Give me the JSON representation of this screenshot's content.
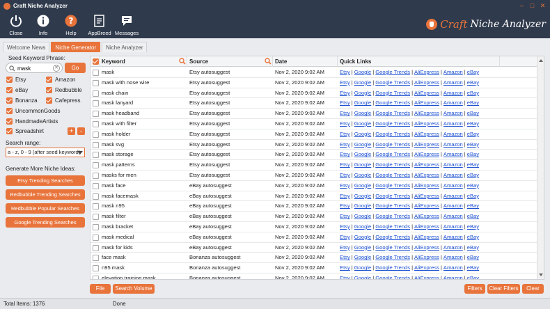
{
  "window": {
    "title": "Craft Niche Analyzer"
  },
  "toolbar": {
    "buttons": [
      {
        "label": "Close"
      },
      {
        "label": "Info"
      },
      {
        "label": "Help"
      },
      {
        "label": "AppBreed"
      },
      {
        "label": "Messages"
      }
    ],
    "brand_word1": "Craft",
    "brand_word2": "Niche Analyzer"
  },
  "tabs": [
    {
      "label": "Welcome News",
      "active": false
    },
    {
      "label": "Niche Generator",
      "active": true
    },
    {
      "label": "Niche Analyzer",
      "active": false
    }
  ],
  "left": {
    "seed_label": "Seed Keyword Phrase:",
    "seed_value": "mask",
    "go_label": "Go",
    "sources": [
      {
        "label": "Etsy",
        "checked": true
      },
      {
        "label": "Amazon",
        "checked": true
      },
      {
        "label": "eBay",
        "checked": true
      },
      {
        "label": "Redbubble",
        "checked": true
      },
      {
        "label": "Bonanza",
        "checked": true
      },
      {
        "label": "Cafepress",
        "checked": true
      },
      {
        "label": "UncommonGoods",
        "checked": true
      },
      {
        "label": "HandmadeArtists",
        "checked": true
      },
      {
        "label": "Spreadshirt",
        "checked": true
      }
    ],
    "plus_label": "+",
    "minus_label": "-",
    "range_label": "Search range:",
    "range_value": "a - z, 0 - 9 (after seed keyword)",
    "more_label": "Generate More Niche Ideas:",
    "gen_buttons": [
      "Etsy Trending Searches",
      "Redbubble Trending Searches",
      "Redbubble Popular Searches",
      "Google Trending Searches"
    ]
  },
  "grid": {
    "columns": [
      "Keyword",
      "Source",
      "Date",
      "Quick Links"
    ],
    "links": [
      "Etsy",
      "Google",
      "Google Trends",
      "AliExpress",
      "Amazon",
      "eBay"
    ],
    "rows": [
      {
        "keyword": "mask",
        "source": "Etsy autosuggest",
        "date": "Nov 2, 2020 9:02 AM"
      },
      {
        "keyword": "mask with nose wire",
        "source": "Etsy autosuggest",
        "date": "Nov 2, 2020 9:02 AM"
      },
      {
        "keyword": "mask chain",
        "source": "Etsy autosuggest",
        "date": "Nov 2, 2020 9:02 AM"
      },
      {
        "keyword": "mask lanyard",
        "source": "Etsy autosuggest",
        "date": "Nov 2, 2020 9:02 AM"
      },
      {
        "keyword": "mask headband",
        "source": "Etsy autosuggest",
        "date": "Nov 2, 2020 9:02 AM"
      },
      {
        "keyword": "mask with filter",
        "source": "Etsy autosuggest",
        "date": "Nov 2, 2020 9:02 AM"
      },
      {
        "keyword": "mask holder",
        "source": "Etsy autosuggest",
        "date": "Nov 2, 2020 9:02 AM"
      },
      {
        "keyword": "mask svg",
        "source": "Etsy autosuggest",
        "date": "Nov 2, 2020 9:02 AM"
      },
      {
        "keyword": "mask storage",
        "source": "Etsy autosuggest",
        "date": "Nov 2, 2020 9:02 AM"
      },
      {
        "keyword": "mask patterns",
        "source": "Etsy autosuggest",
        "date": "Nov 2, 2020 9:02 AM"
      },
      {
        "keyword": "masks for men",
        "source": "Etsy autosuggest",
        "date": "Nov 2, 2020 9:02 AM"
      },
      {
        "keyword": "mask face",
        "source": "eBay autosuggest",
        "date": "Nov 2, 2020 9:02 AM"
      },
      {
        "keyword": "mask facemask",
        "source": "eBay autosuggest",
        "date": "Nov 2, 2020 9:02 AM"
      },
      {
        "keyword": "mask n95",
        "source": "eBay autosuggest",
        "date": "Nov 2, 2020 9:02 AM"
      },
      {
        "keyword": "mask filter",
        "source": "eBay autosuggest",
        "date": "Nov 2, 2020 9:02 AM"
      },
      {
        "keyword": "mask bracket",
        "source": "eBay autosuggest",
        "date": "Nov 2, 2020 9:02 AM"
      },
      {
        "keyword": "mask medical",
        "source": "eBay autosuggest",
        "date": "Nov 2, 2020 9:02 AM"
      },
      {
        "keyword": "mask for kids",
        "source": "eBay autosuggest",
        "date": "Nov 2, 2020 9:02 AM"
      },
      {
        "keyword": "face mask",
        "source": "Bonanza autosuggest",
        "date": "Nov 2, 2020 9:02 AM"
      },
      {
        "keyword": "n95 mask",
        "source": "Bonanza autosuggest",
        "date": "Nov 2, 2020 9:02 AM"
      },
      {
        "keyword": "elevation training mask",
        "source": "Bonanza autosuggest",
        "date": "Nov 2, 2020 9:02 AM"
      }
    ]
  },
  "bottom": {
    "file_label": "File",
    "volume_label": "Search Volume",
    "filters_label": "Filters",
    "clear_filters_label": "Clear Filters",
    "clear_label": "Clear"
  },
  "status": {
    "total": "Total Items: 1376",
    "state": "Done"
  },
  "colors": {
    "accent": "#e8743c",
    "header": "#2f3a4c",
    "link": "#1a4fd1"
  }
}
